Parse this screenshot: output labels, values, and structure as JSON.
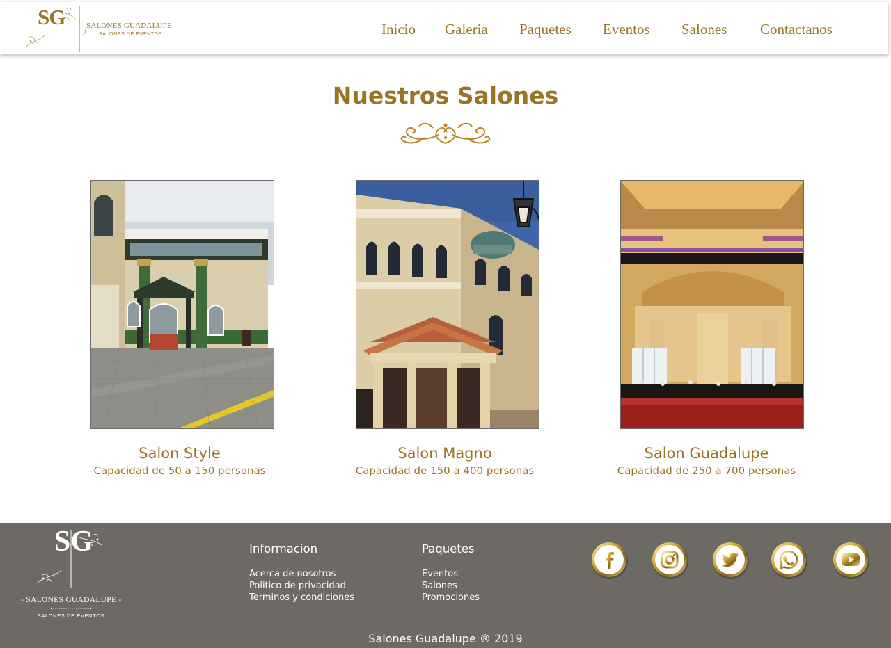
{
  "header": {
    "logo": {
      "initials": "SG",
      "name": "SALONES GUADALUPE",
      "subtitle": "SALONES DE EVENTOS"
    },
    "nav": [
      "Inicio",
      "Galeria",
      "Paquetes",
      "Eventos",
      "Salones",
      "Contactanos"
    ]
  },
  "main": {
    "title": "Nuestros Salones",
    "salones": [
      {
        "name": "Salon Style",
        "capacity": "Capacidad de 50 a 150 personas"
      },
      {
        "name": "Salon Magno",
        "capacity": "Capacidad de 150 a 400 personas"
      },
      {
        "name": "Salon Guadalupe",
        "capacity": "Capacidad de 250 a 700 personas"
      }
    ]
  },
  "footer": {
    "logo": {
      "initials": "SG",
      "name": "- SALONES GUADALUPE -",
      "subtitle": "SALONES DE EVENTOS"
    },
    "informacion": {
      "heading": "Informacion",
      "links": [
        "Acerca de nosotros",
        "Politico de privacidad",
        "Terminos y condiciones"
      ]
    },
    "paquetes": {
      "heading": "Paquetes",
      "links": [
        "Eventos",
        "Salones",
        "Promociones"
      ]
    },
    "social": [
      "facebook-icon",
      "instagram-icon",
      "twitter-icon",
      "whatsapp-icon",
      "youtube-icon"
    ],
    "copyright": "Salones Guadalupe ® 2019"
  },
  "colors": {
    "gold": "#9a7424",
    "footer_bg": "#6d6a65",
    "white": "#ffffff"
  }
}
